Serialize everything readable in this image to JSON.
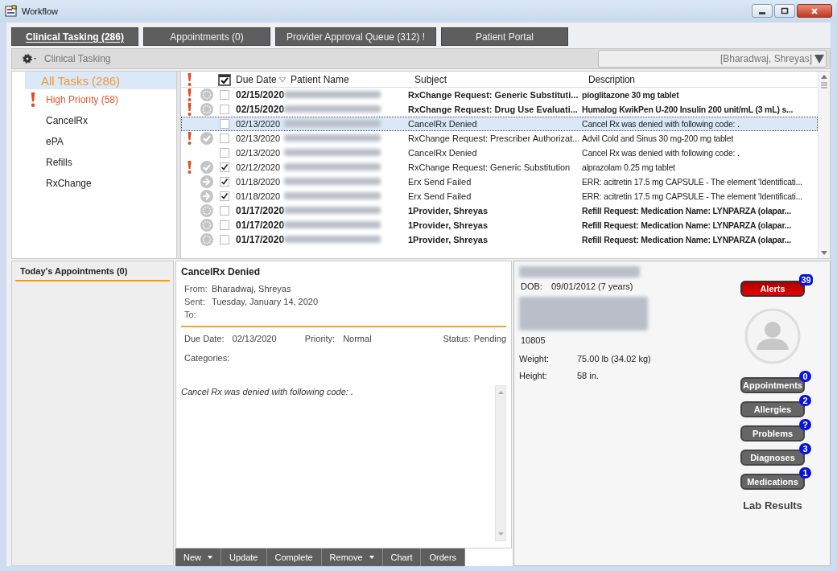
{
  "window": {
    "title": "Workflow"
  },
  "tabs": [
    {
      "label": "Clinical Tasking (286)",
      "selected": true
    },
    {
      "label": "Appointments (0)",
      "selected": false
    },
    {
      "label": "Provider Approval Queue (312) !",
      "selected": false
    },
    {
      "label": "Patient Portal",
      "selected": false
    }
  ],
  "toolbar": {
    "title": "Clinical Tasking",
    "provider_filter": "[Bharadwaj, Shreyas]"
  },
  "task_groups": [
    {
      "label": "All Tasks (286)",
      "kind": "all",
      "selected": true
    },
    {
      "label": "High Priority (58)",
      "kind": "priority",
      "selected": false
    },
    {
      "label": "CancelRx",
      "kind": "plain",
      "selected": false
    },
    {
      "label": "ePA",
      "kind": "plain",
      "selected": false
    },
    {
      "label": "Refills",
      "kind": "plain",
      "selected": false
    },
    {
      "label": "RxChange",
      "kind": "plain",
      "selected": false
    }
  ],
  "table": {
    "columns": [
      "Due Date",
      "Patient Name",
      "Subject",
      "Description"
    ],
    "rows": [
      {
        "priority": true,
        "kind": "pending",
        "checked": false,
        "unread": true,
        "selected": false,
        "due": "02/15/2020",
        "subject": "RxChange Request: Generic Substituti...",
        "description": "pioglitazone 30 mg tablet"
      },
      {
        "priority": true,
        "kind": "pending",
        "checked": false,
        "unread": true,
        "selected": false,
        "due": "02/15/2020",
        "subject": "RxChange Request: Drug Use Evaluati...",
        "description": "Humalog KwikPen U-200 Insulin 200 unit/mL (3 mL) s..."
      },
      {
        "priority": false,
        "kind": "none",
        "checked": false,
        "unread": false,
        "selected": true,
        "due": "02/13/2020",
        "subject": "CancelRx Denied",
        "description": "Cancel Rx was denied with following code: ."
      },
      {
        "priority": true,
        "kind": "done",
        "checked": false,
        "unread": false,
        "selected": false,
        "due": "02/13/2020",
        "subject": "RxChange  Request:  Prescriber Authorizat...",
        "description": "Advil Cold and Sinus 30 mg-200 mg tablet"
      },
      {
        "priority": false,
        "kind": "none",
        "checked": false,
        "unread": false,
        "selected": false,
        "due": "02/13/2020",
        "subject": "CancelRx Denied",
        "description": "Cancel Rx was denied with following code: ."
      },
      {
        "priority": true,
        "kind": "done",
        "checked": true,
        "unread": false,
        "selected": false,
        "due": "02/12/2020",
        "subject": "RxChange Request: Generic Substitution",
        "description": "alprazolam 0.25 mg tablet"
      },
      {
        "priority": false,
        "kind": "sent",
        "checked": true,
        "unread": false,
        "selected": false,
        "due": "01/18/2020",
        "subject": "Erx Send Failed",
        "description": "ERR: acitretin 17.5 mg CAPSULE - The element 'Identificati..."
      },
      {
        "priority": false,
        "kind": "sent",
        "checked": true,
        "unread": false,
        "selected": false,
        "due": "01/18/2020",
        "subject": "Erx Send Failed",
        "description": "ERR: acitretin 17.5 mg CAPSULE - The element 'Identificati..."
      },
      {
        "priority": false,
        "kind": "pending",
        "checked": false,
        "unread": true,
        "selected": false,
        "due": "01/17/2020",
        "subject": "1Provider, Shreyas",
        "description": "Refill Request:  Medication Name:  LYNPARZA (olapar..."
      },
      {
        "priority": false,
        "kind": "pending",
        "checked": false,
        "unread": true,
        "selected": false,
        "due": "01/17/2020",
        "subject": "1Provider, Shreyas",
        "description": "Refill Request:  Medication Name:  LYNPARZA (olapar..."
      },
      {
        "priority": false,
        "kind": "pending",
        "checked": false,
        "unread": true,
        "selected": false,
        "due": "01/17/2020",
        "subject": "1Provider, Shreyas",
        "description": "Refill Request:  Medication Name:  LYNPARZA (olapar..."
      }
    ]
  },
  "appointments_panel": {
    "title": "Today's Appointments (0)"
  },
  "message": {
    "subject": "CancelRx Denied",
    "header": [
      {
        "label": "From:",
        "value": "Bharadwaj, Shreyas"
      },
      {
        "label": "Sent:",
        "value": "Tuesday, January 14, 2020"
      },
      {
        "label": "To:"
      }
    ],
    "fields": [
      {
        "label": "Due Date:",
        "value": "02/13/2020"
      },
      {
        "label": "Priority:",
        "value": "Normal"
      },
      {
        "label": "Status:",
        "value": "Pending"
      }
    ],
    "categories_label": "Categories:",
    "body": "Cancel Rx was denied with following code: ."
  },
  "actions": [
    {
      "label": "New",
      "menu": true
    },
    {
      "label": "Update",
      "menu": false
    },
    {
      "label": "Complete",
      "menu": false
    },
    {
      "label": "Remove",
      "menu": true
    },
    {
      "label": "Chart",
      "menu": false
    },
    {
      "label": "Orders",
      "menu": false
    }
  ],
  "patient": {
    "dob_label": "DOB:",
    "dob": "09/01/2012 (7 years)",
    "id": "10805",
    "vitals": [
      {
        "label": "Weight:",
        "value": "75.00 lb (34.02 kg)"
      },
      {
        "label": "Height:",
        "value": "58 in."
      }
    ],
    "alerts": {
      "label": "Alerts",
      "count": "39"
    },
    "sections": [
      {
        "label": "Appointments",
        "count": "0"
      },
      {
        "label": "Allergies",
        "count": "2"
      },
      {
        "label": "Problems",
        "count": "?"
      },
      {
        "label": "Diagnoses",
        "count": "3"
      },
      {
        "label": "Medications",
        "count": "1"
      }
    ],
    "lab_results": "Lab Results"
  }
}
